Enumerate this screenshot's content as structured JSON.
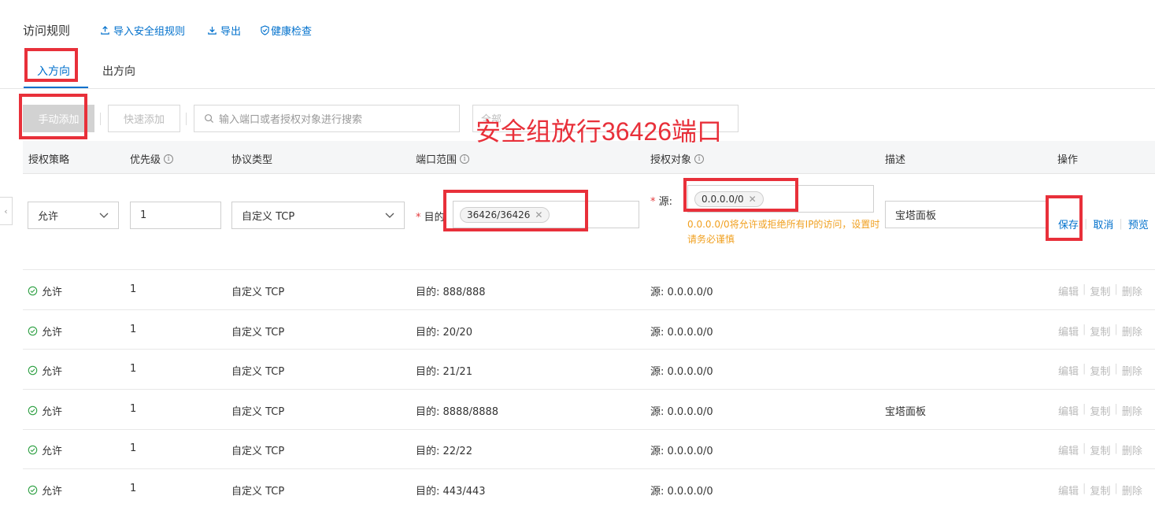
{
  "header": {
    "title": "访问规则",
    "import_label": "导入安全组规则",
    "export_label": "导出",
    "health_label": "健康检查"
  },
  "tabs": [
    {
      "label": "入方向",
      "active": true
    },
    {
      "label": "出方向",
      "active": false
    }
  ],
  "toolbar": {
    "manual_add": "手动添加",
    "quick_add": "快速添加",
    "search_placeholder": "输入端口或者授权对象进行搜索",
    "filter_placeholder": "全部"
  },
  "columns": {
    "policy": "授权策略",
    "priority": "优先级",
    "protocol": "协议类型",
    "port_range": "端口范围",
    "auth_object": "授权对象",
    "description": "描述",
    "actions": "操作"
  },
  "edit_row": {
    "policy": "允许",
    "priority": "1",
    "protocol": "自定义 TCP",
    "port_label": "目的",
    "port_tag": "36426/36426",
    "source_label": "源:",
    "source_tag": "0.0.0.0/0",
    "warning": "0.0.0.0/0将允许或拒绝所有IP的访问，设置时请务必谨慎",
    "description": "宝塔面板",
    "save": "保存",
    "cancel": "取消",
    "preview": "预览"
  },
  "rows": [
    {
      "policy": "允许",
      "priority": "1",
      "protocol": "自定义 TCP",
      "port": "目的: 888/888",
      "source": "源: 0.0.0.0/0",
      "desc": ""
    },
    {
      "policy": "允许",
      "priority": "1",
      "protocol": "自定义 TCP",
      "port": "目的: 20/20",
      "source": "源: 0.0.0.0/0",
      "desc": ""
    },
    {
      "policy": "允许",
      "priority": "1",
      "protocol": "自定义 TCP",
      "port": "目的: 21/21",
      "source": "源: 0.0.0.0/0",
      "desc": ""
    },
    {
      "policy": "允许",
      "priority": "1",
      "protocol": "自定义 TCP",
      "port": "目的: 8888/8888",
      "source": "源: 0.0.0.0/0",
      "desc": "宝塔面板"
    },
    {
      "policy": "允许",
      "priority": "1",
      "protocol": "自定义 TCP",
      "port": "目的: 22/22",
      "source": "源: 0.0.0.0/0",
      "desc": ""
    },
    {
      "policy": "允许",
      "priority": "1",
      "protocol": "自定义 TCP",
      "port": "目的: 443/443",
      "source": "源: 0.0.0.0/0",
      "desc": ""
    }
  ],
  "row_actions": {
    "edit": "编辑",
    "copy": "复制",
    "delete": "删除"
  },
  "annotation": "安全组放行36426端口",
  "colors": {
    "accent": "#0070cc",
    "annotation": "#e8303a",
    "warning": "#f0a020",
    "allow": "#2ea043"
  }
}
